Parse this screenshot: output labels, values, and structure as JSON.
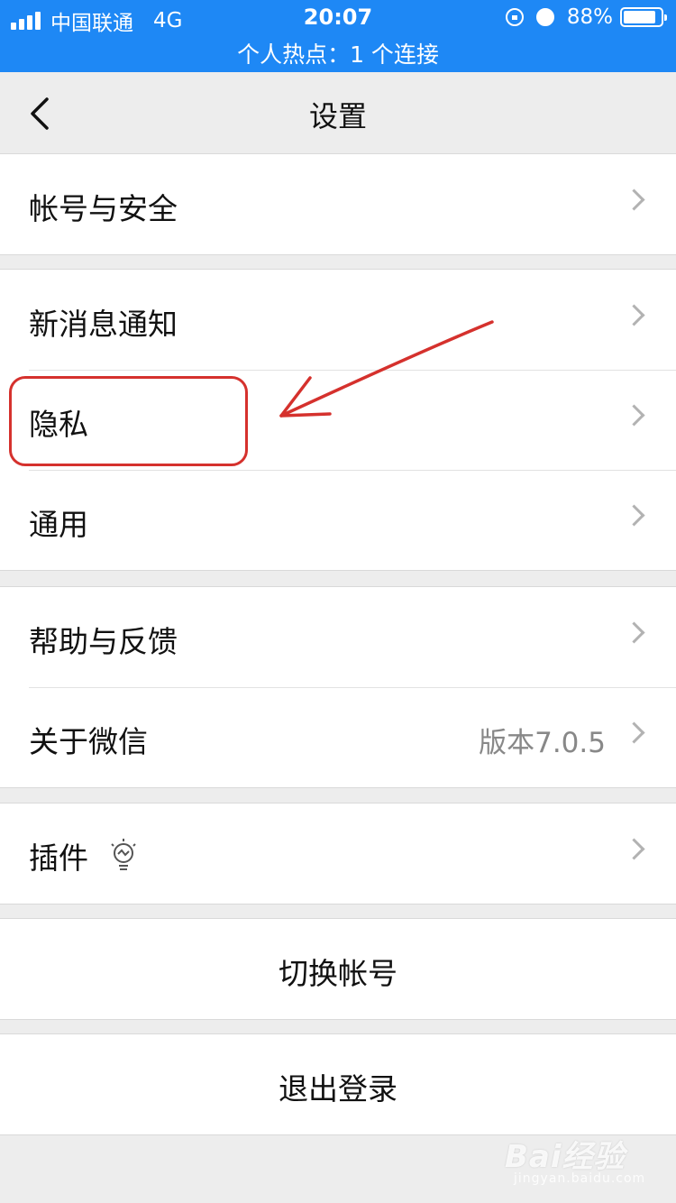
{
  "status_bar": {
    "carrier": "中国联通",
    "network": "4G",
    "time": "20:07",
    "battery_percent": "88%",
    "battery_level": 0.88,
    "hotspot": "个人热点：1 个连接",
    "bar_color": "#1e88f5"
  },
  "nav": {
    "title": "设置",
    "back_icon": "chevron-left-icon"
  },
  "groups": {
    "account": {
      "account_security": "帐号与安全"
    },
    "prefs": {
      "notifications": "新消息通知",
      "privacy": "隐私",
      "general": "通用"
    },
    "support": {
      "help_feedback": "帮助与反馈",
      "about": "关于微信",
      "version": "版本7.0.5"
    },
    "plugins": {
      "plugins": "插件",
      "plugin_icon": "lightbulb-icon"
    },
    "switch_account": "切换帐号",
    "logout": "退出登录"
  },
  "annotation": {
    "highlight_color": "#d5312d"
  },
  "watermark": {
    "main": "Bai经验",
    "sub": "jingyan.baidu.com"
  }
}
